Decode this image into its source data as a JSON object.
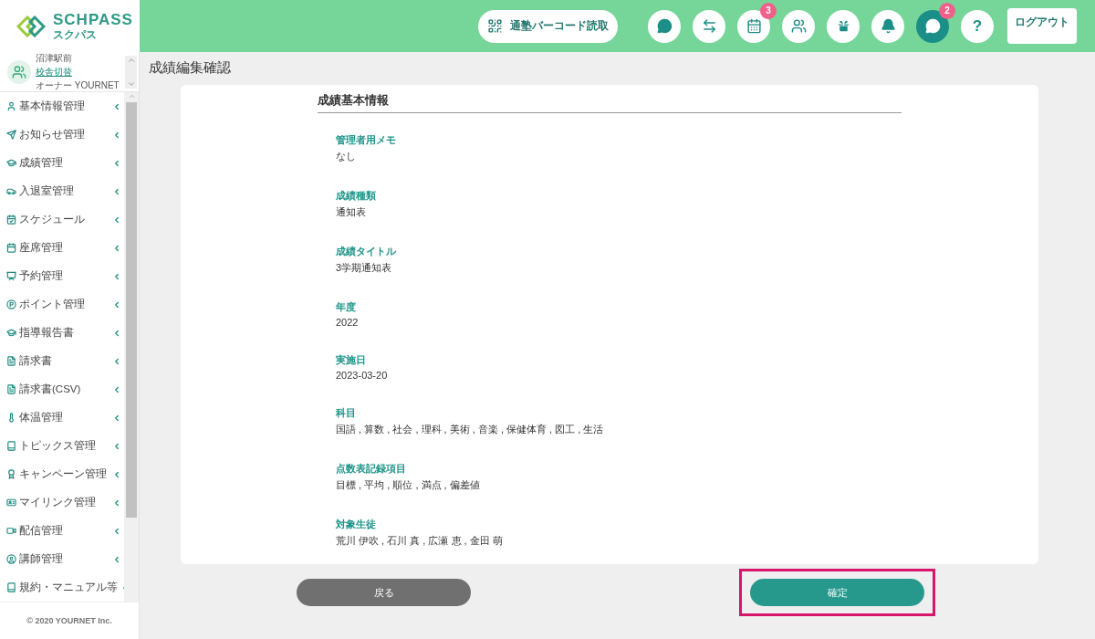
{
  "logo": {
    "name": "SCHPASS",
    "kana": "スクパス"
  },
  "header": {
    "barcode_button": "通塾バーコード読取",
    "icons": [
      {
        "kind": "chat",
        "active": false
      },
      {
        "kind": "transfer",
        "active": false
      },
      {
        "kind": "calendar",
        "active": false,
        "badge": "3"
      },
      {
        "kind": "people",
        "active": false
      },
      {
        "kind": "gift",
        "active": false
      },
      {
        "kind": "bell",
        "active": false
      },
      {
        "kind": "chat",
        "active": true,
        "badge": "2"
      },
      {
        "kind": "help",
        "active": false,
        "label": "?"
      }
    ],
    "logout": "ログアウト"
  },
  "user": {
    "school": "沼津駅前",
    "switch_link": "校舎切替",
    "role": "オーナー YOURNET"
  },
  "sidebar": {
    "items": [
      {
        "kind": "user",
        "label": "基本情報管理"
      },
      {
        "kind": "send",
        "label": "お知らせ管理"
      },
      {
        "kind": "cap",
        "label": "成績管理"
      },
      {
        "kind": "car",
        "label": "入退室管理"
      },
      {
        "kind": "calcheck",
        "label": "スケジュール"
      },
      {
        "kind": "calendar",
        "label": "座席管理"
      },
      {
        "kind": "board",
        "label": "予約管理"
      },
      {
        "kind": "point",
        "label": "ポイント管理"
      },
      {
        "kind": "cap",
        "label": "指導報告書"
      },
      {
        "kind": "invoice",
        "label": "請求書"
      },
      {
        "kind": "invoice",
        "label": "請求書(CSV)"
      },
      {
        "kind": "thermo",
        "label": "体温管理"
      },
      {
        "kind": "book",
        "label": "トピックス管理"
      },
      {
        "kind": "award",
        "label": "キャンペーン管理"
      },
      {
        "kind": "idcard",
        "label": "マイリンク管理"
      },
      {
        "kind": "video",
        "label": "配信管理"
      },
      {
        "kind": "usercircle",
        "label": "講師管理"
      },
      {
        "kind": "book",
        "label": "規約・マニュアル等"
      }
    ],
    "footer": "© 2020 YOURNET Inc."
  },
  "page_title": "成績編集確認",
  "section_title": "成績基本情報",
  "fields": [
    {
      "label": "管理者用メモ",
      "value": "なし"
    },
    {
      "label": "成績種類",
      "value": "通知表"
    },
    {
      "label": "成績タイトル",
      "value": "3学期通知表"
    },
    {
      "label": "年度",
      "value": "2022"
    },
    {
      "label": "実施日",
      "value": "2023-03-20"
    },
    {
      "label": "科目",
      "value": "国語 , 算数 , 社会 , 理科 , 美術 , 音楽 , 保健体育 , 図工 , 生活"
    },
    {
      "label": "点数表記録項目",
      "value": "目標 , 平均 , 順位 , 満点 , 偏差値"
    },
    {
      "label": "対象生徒",
      "value": "荒川 伊吹 , 石川 真 , 広瀬 恵 , 金田 萌"
    }
  ],
  "buttons": {
    "back": "戻る",
    "confirm": "確定",
    "confirm_highlighted": true
  }
}
